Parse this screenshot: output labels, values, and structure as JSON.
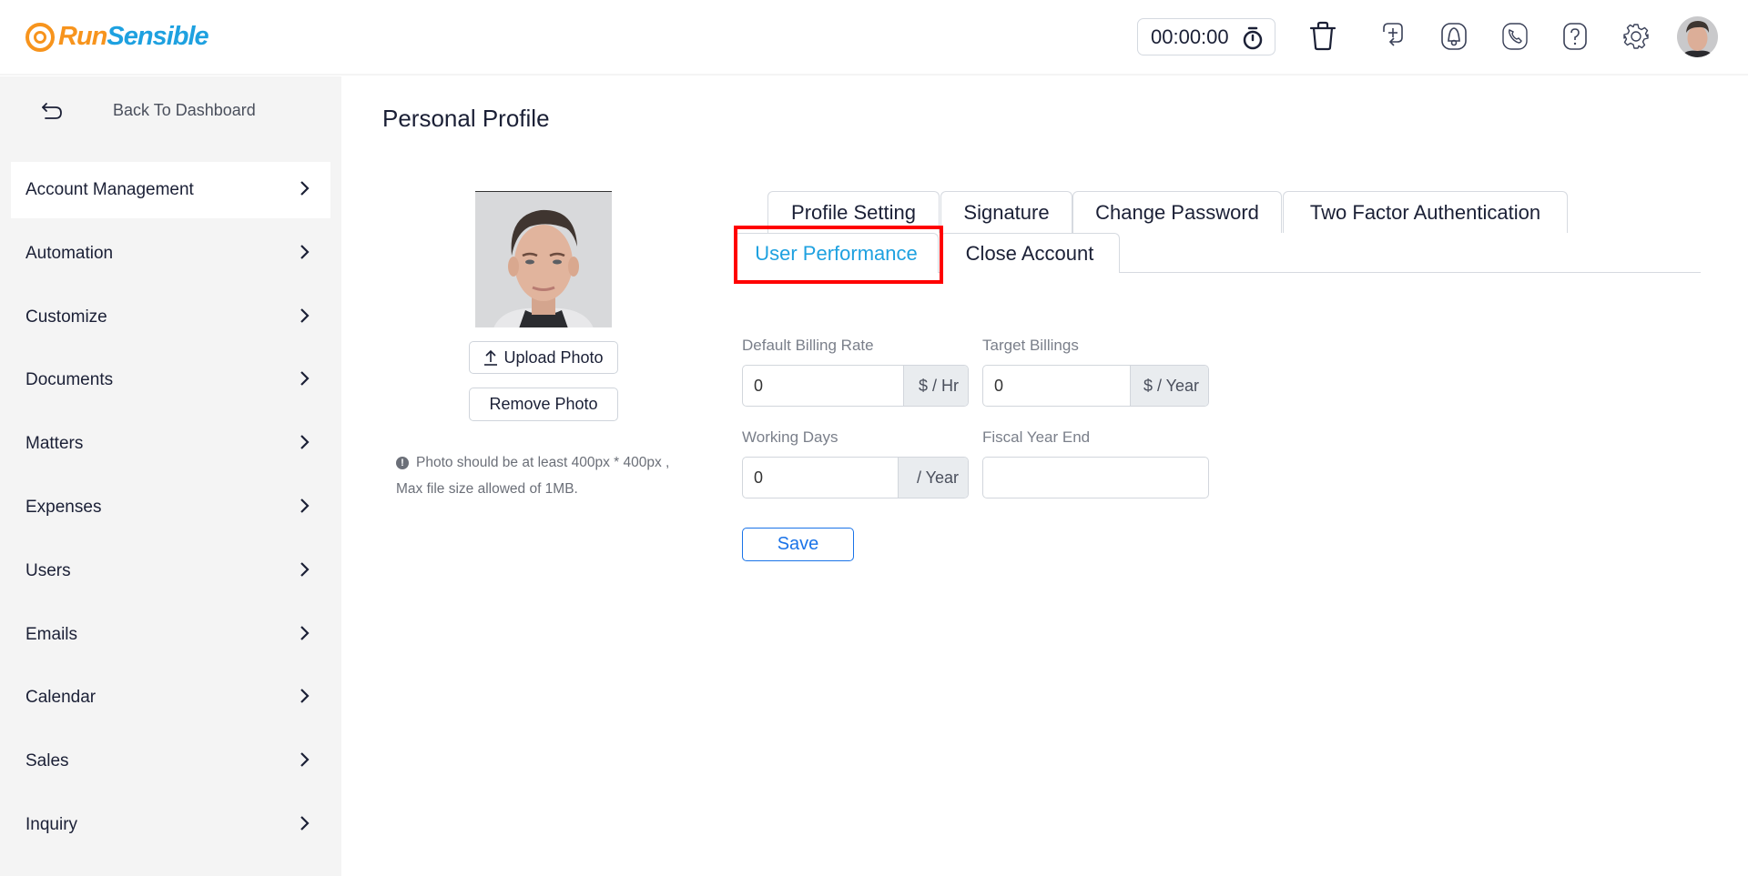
{
  "header": {
    "logo": {
      "part1": "Run",
      "part2": "Sensible"
    },
    "timer": {
      "value": "00:00:00",
      "icon": "stopwatch-icon"
    },
    "icons": [
      "trash-icon",
      "add-task-icon",
      "bell-icon",
      "phone-icon",
      "help-icon",
      "gear-icon"
    ],
    "avatar": "user-avatar"
  },
  "colors": {
    "brand_orange": "#f7941d",
    "brand_blue": "#1ea1e0",
    "active_tab": "#1ea1e0",
    "save_button": "#1a73e8",
    "highlight": "#ff0000",
    "sidebar_bg": "#f4f4f4"
  },
  "sidebar": {
    "back_label": "Back To Dashboard",
    "items": [
      {
        "label": "Account Management",
        "active": true
      },
      {
        "label": "Automation"
      },
      {
        "label": "Customize"
      },
      {
        "label": "Documents"
      },
      {
        "label": "Matters"
      },
      {
        "label": "Expenses"
      },
      {
        "label": "Users"
      },
      {
        "label": "Emails"
      },
      {
        "label": "Calendar"
      },
      {
        "label": "Sales"
      },
      {
        "label": "Inquiry"
      }
    ]
  },
  "main": {
    "title": "Personal Profile",
    "photo": {
      "upload_label": "Upload Photo",
      "remove_label": "Remove Photo",
      "note_line1": "Photo should be at least 400px * 400px ,",
      "note_line2": "Max file size allowed of 1MB."
    },
    "tabs": [
      {
        "label": "Profile Setting"
      },
      {
        "label": "Signature"
      },
      {
        "label": "Change Password"
      },
      {
        "label": "Two Factor Authentication"
      },
      {
        "label": "User Performance",
        "active": true
      },
      {
        "label": "Close Account"
      }
    ],
    "form": {
      "billing_rate": {
        "label": "Default Billing Rate",
        "value": "0",
        "addon": "$ / Hr"
      },
      "target_billings": {
        "label": "Target Billings",
        "value": "0",
        "addon": "$ / Year"
      },
      "working_days": {
        "label": "Working Days",
        "value": "0",
        "addon": "/ Year"
      },
      "fiscal_year_end": {
        "label": "Fiscal Year End",
        "value": ""
      },
      "save_label": "Save"
    }
  }
}
